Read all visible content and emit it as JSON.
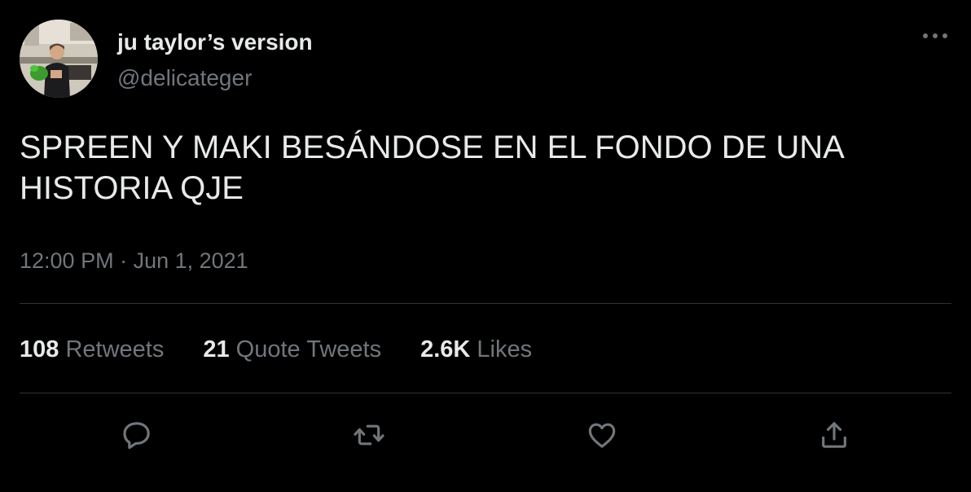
{
  "author": {
    "display_name": "ju taylor’s version",
    "handle": "@delicateger"
  },
  "tweet": {
    "text": "SPREEN Y MAKI BESÁNDOSE EN EL FONDO DE UNA HISTORIA QJE",
    "time": "12:00 PM",
    "separator": " · ",
    "date": "Jun 1, 2021"
  },
  "stats": {
    "retweets": {
      "count": "108",
      "label": "Retweets"
    },
    "quotes": {
      "count": "21",
      "label": "Quote Tweets"
    },
    "likes": {
      "count": "2.6K",
      "label": "Likes"
    }
  },
  "actions": [
    "reply-icon",
    "retweet-icon",
    "like-icon",
    "share-icon"
  ],
  "colors": {
    "background": "#000000",
    "primary_text": "#e7e9ea",
    "secondary_text": "#71767b",
    "divider": "#2f3336"
  }
}
